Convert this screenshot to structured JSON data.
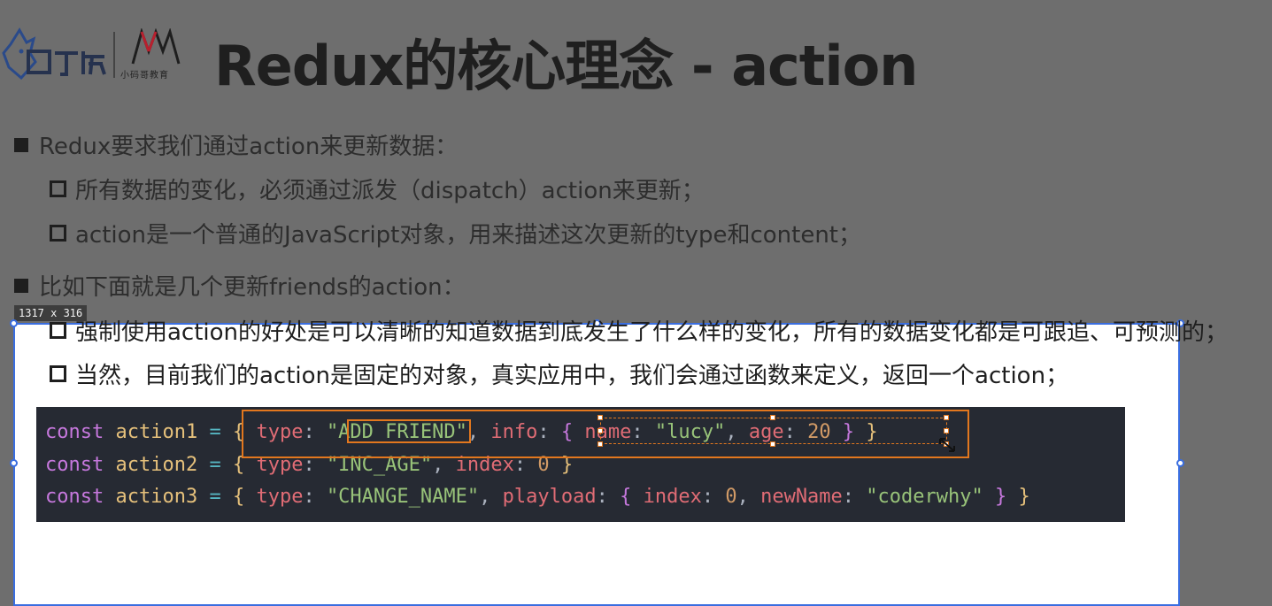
{
  "header": {
    "logo_text": "coderwhy",
    "logo_sub": "小码哥教育",
    "title": "Redux的核心理念 - action"
  },
  "bullets": [
    {
      "level": 1,
      "text": "Redux要求我们通过action来更新数据："
    },
    {
      "level": 2,
      "text": "所有数据的变化，必须通过派发（dispatch）action来更新；"
    },
    {
      "level": 2,
      "text": "action是一个普通的JavaScript对象，用来描述这次更新的type和content；"
    },
    {
      "level": 1,
      "text": "比如下面就是几个更新friends的action："
    },
    {
      "level": 2,
      "text": "强制使用action的好处是可以清晰的知道数据到底发生了什么样的变化，所有的数据变化都是可跟追、可预测的；"
    },
    {
      "level": 2,
      "text": "当然，目前我们的action是固定的对象，真实应用中，我们会通过函数来定义，返回一个action；"
    }
  ],
  "selection": {
    "size_label": "1317 x 316"
  },
  "code": {
    "lines": [
      "const action1 = { type: \"ADD_FRIEND\", info: { name: \"lucy\", age: 20 } }",
      "const action2 = { type: \"INC_AGE\", index: 0 }",
      "const action3 = { type: \"CHANGE_NAME\", playload: { index: 0, newName: \"coderwhy\" } }"
    ]
  },
  "colors": {
    "accent_selection": "#3a6ee0",
    "annotation_box": "#e2771e",
    "code_bg": "#262a33"
  }
}
